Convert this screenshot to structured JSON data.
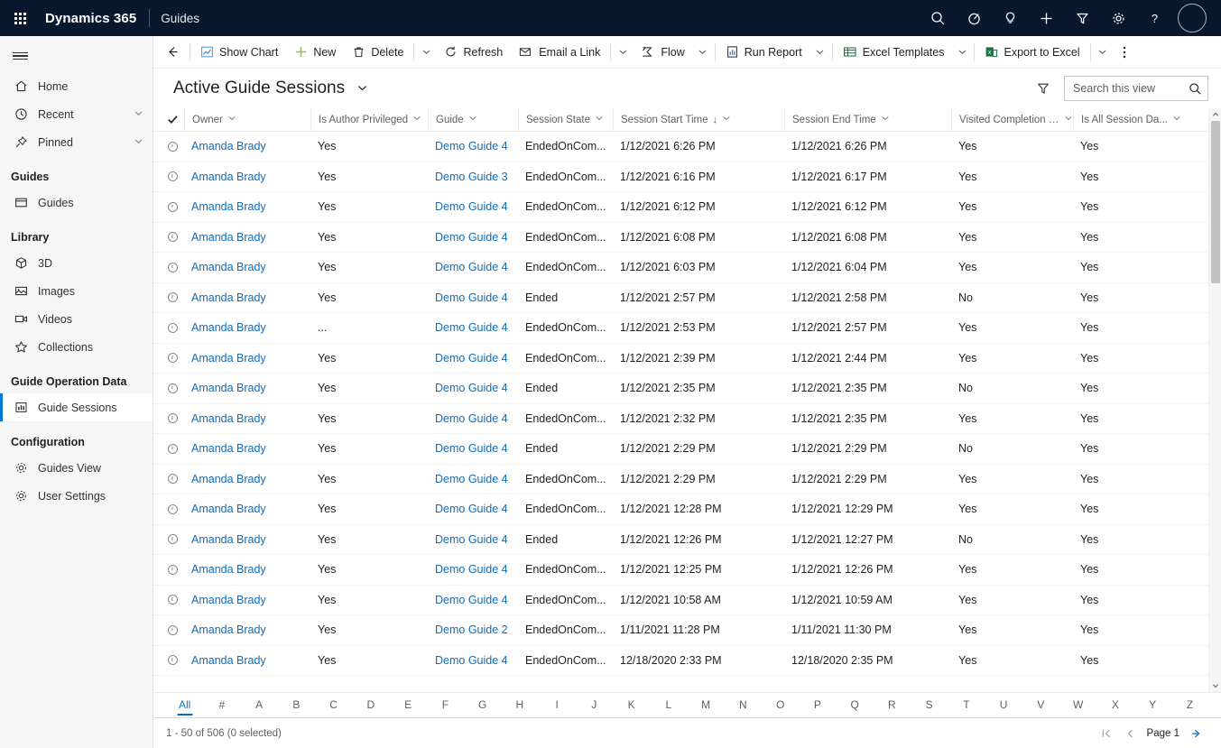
{
  "topbar": {
    "waffle_title": "app-launcher",
    "brand": "Dynamics 365",
    "app_name": "Guides",
    "icons": [
      {
        "name": "search-icon",
        "title": "Search"
      },
      {
        "name": "assistant-icon",
        "title": "Assistant"
      },
      {
        "name": "lightbulb-icon",
        "title": "Ideas"
      },
      {
        "name": "plus-icon",
        "title": "Quick create"
      },
      {
        "name": "filter-icon",
        "title": "Filter"
      },
      {
        "name": "gear-icon",
        "title": "Settings"
      },
      {
        "name": "help-icon",
        "title": "Help"
      }
    ],
    "avatar_label": ""
  },
  "sidebar": {
    "hamburger_label": "Expand navigation",
    "items": [
      {
        "label": "Home",
        "icon": "home-icon",
        "chevron": false,
        "selected": false
      },
      {
        "label": "Recent",
        "icon": "clock-icon",
        "chevron": true,
        "selected": false
      },
      {
        "label": "Pinned",
        "icon": "pin-icon",
        "chevron": true,
        "selected": false
      }
    ],
    "groups": [
      {
        "title": "Guides",
        "items": [
          {
            "label": "Guides",
            "icon": "window-icon",
            "selected": false
          }
        ]
      },
      {
        "title": "Library",
        "items": [
          {
            "label": "3D",
            "icon": "cube-icon",
            "selected": false
          },
          {
            "label": "Images",
            "icon": "image-icon",
            "selected": false
          },
          {
            "label": "Videos",
            "icon": "video-icon",
            "selected": false
          },
          {
            "label": "Collections",
            "icon": "star-icon",
            "selected": false
          }
        ]
      },
      {
        "title": "Guide Operation Data",
        "items": [
          {
            "label": "Guide Sessions",
            "icon": "chart-icon",
            "selected": true
          }
        ]
      },
      {
        "title": "Configuration",
        "items": [
          {
            "label": "Guides View",
            "icon": "gear-icon",
            "selected": false
          },
          {
            "label": "User Settings",
            "icon": "gear-icon",
            "selected": false
          }
        ]
      }
    ]
  },
  "commandbar": {
    "back_label": "Back",
    "buttons": [
      {
        "label": "Show Chart",
        "icon": "chart-icon"
      },
      {
        "label": "New",
        "icon": "plus-icon"
      },
      {
        "label": "Delete",
        "icon": "trash-icon"
      },
      {
        "label": "Refresh",
        "icon": "refresh-icon"
      },
      {
        "label": "Email a Link",
        "icon": "email-icon"
      },
      {
        "label": "Flow",
        "icon": "flow-icon"
      },
      {
        "label": "Run Report",
        "icon": "report-icon"
      },
      {
        "label": "Excel Templates",
        "icon": "excel-template-icon"
      },
      {
        "label": "Export to Excel",
        "icon": "excel-icon"
      }
    ],
    "overflow_label": "More commands"
  },
  "view": {
    "title": "Active Guide Sessions",
    "filter_label": "Edit filters",
    "search": {
      "placeholder": "Search this view",
      "value": ""
    }
  },
  "grid": {
    "select_all_label": "Select all",
    "columns": [
      {
        "key": "owner",
        "label": "Owner",
        "sorted": false
      },
      {
        "key": "auth",
        "label": "Is Author Privileged",
        "sorted": false
      },
      {
        "key": "guide",
        "label": "Guide",
        "sorted": false
      },
      {
        "key": "state",
        "label": "Session State",
        "sorted": false
      },
      {
        "key": "start",
        "label": "Session Start Time",
        "sorted": true,
        "sort_dir": "↓"
      },
      {
        "key": "end",
        "label": "Session End Time",
        "sorted": false
      },
      {
        "key": "visited",
        "label": "Visited Completion S...",
        "sorted": false
      },
      {
        "key": "alldata",
        "label": "Is All Session Da...",
        "sorted": false
      }
    ],
    "rows": [
      {
        "owner": "Amanda Brady",
        "auth": "Yes",
        "guide": "Demo Guide 4",
        "state": "EndedOnCom...",
        "start": "1/12/2021 6:26 PM",
        "end": "1/12/2021 6:26 PM",
        "visited": "Yes",
        "alldata": "Yes"
      },
      {
        "owner": "Amanda Brady",
        "auth": "Yes",
        "guide": "Demo Guide 3",
        "state": "EndedOnCom...",
        "start": "1/12/2021 6:16 PM",
        "end": "1/12/2021 6:17 PM",
        "visited": "Yes",
        "alldata": "Yes"
      },
      {
        "owner": "Amanda Brady",
        "auth": "Yes",
        "guide": "Demo Guide 4",
        "state": "EndedOnCom...",
        "start": "1/12/2021 6:12 PM",
        "end": "1/12/2021 6:12 PM",
        "visited": "Yes",
        "alldata": "Yes"
      },
      {
        "owner": "Amanda Brady",
        "auth": "Yes",
        "guide": "Demo Guide 4",
        "state": "EndedOnCom...",
        "start": "1/12/2021 6:08 PM",
        "end": "1/12/2021 6:08 PM",
        "visited": "Yes",
        "alldata": "Yes"
      },
      {
        "owner": "Amanda Brady",
        "auth": "Yes",
        "guide": "Demo Guide 4",
        "state": "EndedOnCom...",
        "start": "1/12/2021 6:03 PM",
        "end": "1/12/2021 6:04 PM",
        "visited": "Yes",
        "alldata": "Yes"
      },
      {
        "owner": "Amanda Brady",
        "auth": "Yes",
        "guide": "Demo Guide 4",
        "state": "Ended",
        "start": "1/12/2021 2:57 PM",
        "end": "1/12/2021 2:58 PM",
        "visited": "No",
        "alldata": "Yes"
      },
      {
        "owner": "Amanda Brady",
        "auth": "...",
        "guide": "Demo Guide 4",
        "state": "EndedOnCom...",
        "start": "1/12/2021 2:53 PM",
        "end": "1/12/2021 2:57 PM",
        "visited": "Yes",
        "alldata": "Yes"
      },
      {
        "owner": "Amanda Brady",
        "auth": "Yes",
        "guide": "Demo Guide 4",
        "state": "EndedOnCom...",
        "start": "1/12/2021 2:39 PM",
        "end": "1/12/2021 2:44 PM",
        "visited": "Yes",
        "alldata": "Yes"
      },
      {
        "owner": "Amanda Brady",
        "auth": "Yes",
        "guide": "Demo Guide 4",
        "state": "Ended",
        "start": "1/12/2021 2:35 PM",
        "end": "1/12/2021 2:35 PM",
        "visited": "No",
        "alldata": "Yes"
      },
      {
        "owner": "Amanda Brady",
        "auth": "Yes",
        "guide": "Demo Guide 4",
        "state": "EndedOnCom...",
        "start": "1/12/2021 2:32 PM",
        "end": "1/12/2021 2:35 PM",
        "visited": "Yes",
        "alldata": "Yes"
      },
      {
        "owner": "Amanda Brady",
        "auth": "Yes",
        "guide": "Demo Guide 4",
        "state": "Ended",
        "start": "1/12/2021 2:29 PM",
        "end": "1/12/2021 2:29 PM",
        "visited": "No",
        "alldata": "Yes"
      },
      {
        "owner": "Amanda Brady",
        "auth": "Yes",
        "guide": "Demo Guide 4",
        "state": "EndedOnCom...",
        "start": "1/12/2021 2:29 PM",
        "end": "1/12/2021 2:29 PM",
        "visited": "Yes",
        "alldata": "Yes"
      },
      {
        "owner": "Amanda Brady",
        "auth": "Yes",
        "guide": "Demo Guide 4",
        "state": "EndedOnCom...",
        "start": "1/12/2021 12:28 PM",
        "end": "1/12/2021 12:29 PM",
        "visited": "Yes",
        "alldata": "Yes"
      },
      {
        "owner": "Amanda Brady",
        "auth": "Yes",
        "guide": "Demo Guide 4",
        "state": "Ended",
        "start": "1/12/2021 12:26 PM",
        "end": "1/12/2021 12:27 PM",
        "visited": "No",
        "alldata": "Yes"
      },
      {
        "owner": "Amanda Brady",
        "auth": "Yes",
        "guide": "Demo Guide 4",
        "state": "EndedOnCom...",
        "start": "1/12/2021 12:25 PM",
        "end": "1/12/2021 12:26 PM",
        "visited": "Yes",
        "alldata": "Yes"
      },
      {
        "owner": "Amanda Brady",
        "auth": "Yes",
        "guide": "Demo Guide 4",
        "state": "EndedOnCom...",
        "start": "1/12/2021 10:58 AM",
        "end": "1/12/2021 10:59 AM",
        "visited": "Yes",
        "alldata": "Yes"
      },
      {
        "owner": "Amanda Brady",
        "auth": "Yes",
        "guide": "Demo Guide 2",
        "state": "EndedOnCom...",
        "start": "1/11/2021 11:28 PM",
        "end": "1/11/2021 11:30 PM",
        "visited": "Yes",
        "alldata": "Yes"
      },
      {
        "owner": "Amanda Brady",
        "auth": "Yes",
        "guide": "Demo Guide 4",
        "state": "EndedOnCom...",
        "start": "12/18/2020 2:33 PM",
        "end": "12/18/2020 2:35 PM",
        "visited": "Yes",
        "alldata": "Yes"
      }
    ]
  },
  "alphabet": {
    "active": "All",
    "items": [
      "All",
      "#",
      "A",
      "B",
      "C",
      "D",
      "E",
      "F",
      "G",
      "H",
      "I",
      "J",
      "K",
      "L",
      "M",
      "N",
      "O",
      "P",
      "Q",
      "R",
      "S",
      "T",
      "U",
      "V",
      "W",
      "X",
      "Y",
      "Z"
    ]
  },
  "status": {
    "record_count": "1 - 50 of 506 (0 selected)",
    "pager": {
      "first_label": "First page",
      "prev_label": "Previous page",
      "page_label": "Page 1",
      "next_label": "Next page"
    }
  },
  "colors": {
    "topbar_bg": "#09182e",
    "accent": "#0f6cbd",
    "sidebar_bg": "#f6f6f6",
    "link": "#0f6cbd",
    "excel_green": "#1d7044"
  }
}
